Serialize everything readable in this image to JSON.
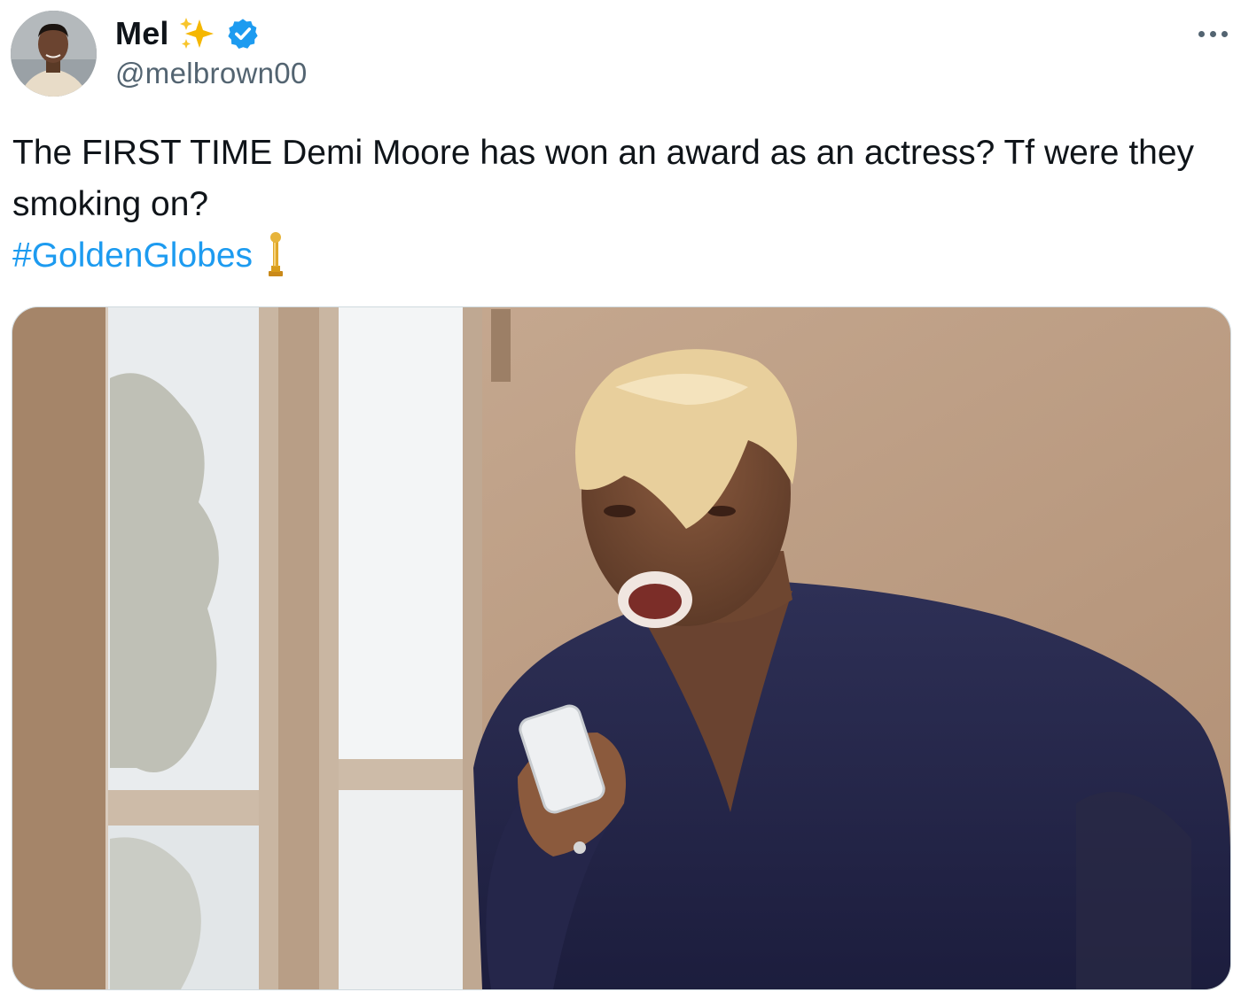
{
  "author": {
    "display_name": "Mel",
    "handle": "@melbrown00",
    "badge_emoji": "sparkles-icon",
    "verified": true
  },
  "menu": {
    "more_icon": "more-horizontal-icon"
  },
  "tweet": {
    "text": "The FIRST TIME Demi Moore has won an award as an actress? Tf were they smoking on?",
    "hashtag": "#GoldenGlobes",
    "trophy_emoji": "golden-globe-trophy-icon"
  },
  "media": {
    "type": "gif",
    "description_icon": "media-image"
  },
  "colors": {
    "link": "#1d9bf0",
    "verified": "#1d9bf0",
    "text": "#0f1419",
    "secondary": "#536471",
    "sparkle": "#f5b700",
    "trophy": "#d89b1a"
  }
}
